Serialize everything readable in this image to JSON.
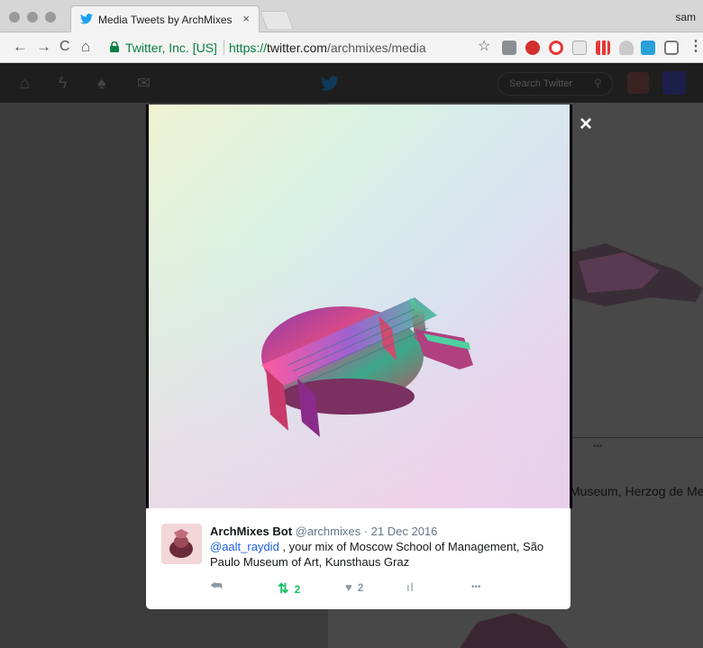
{
  "browser": {
    "tab": {
      "title": "Media Tweets by ArchMixes Bo",
      "title_fade": "t",
      "close": "×"
    },
    "profile_name": "sam",
    "nav": {
      "back": "←",
      "forward": "→",
      "reload": "C",
      "home": "⌂"
    },
    "omnibox": {
      "secure_label": "Twitter, Inc. [US]",
      "url_scheme": "https://",
      "url_host": "twitter.com",
      "url_path": "/archmixes/media"
    },
    "star": "☆",
    "menu": "⋮"
  },
  "twitter_nav": {
    "search_placeholder": "Search Twitter"
  },
  "background": {
    "partial_text": "Museum, Herzog de Me",
    "more_dots": "•••"
  },
  "lightbox": {
    "close": "×"
  },
  "tweet": {
    "name": "ArchMixes Bot",
    "handle": "@archmixes",
    "separator": " · ",
    "date": "21 Dec 2016",
    "mention": "@aalt_raydid",
    "text": " , your mix of Moscow School of Management, São Paulo Museum of Art, Kunsthaus Graz",
    "retweets": "2",
    "likes": "2",
    "more": "•••"
  },
  "colors": {
    "twitter_blue": "#1da1f2",
    "secure_green": "#0b8043",
    "retweet_green": "#17bf63"
  }
}
